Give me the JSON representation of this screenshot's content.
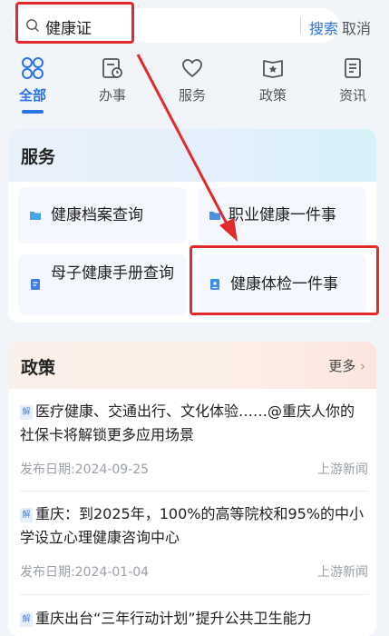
{
  "search": {
    "query": "健康证",
    "search_label": "搜索",
    "cancel_label": "取消"
  },
  "tabs": [
    {
      "label": "全部",
      "icon": "grid-icon",
      "active": true
    },
    {
      "label": "办事",
      "icon": "clipboard-clock-icon",
      "active": false
    },
    {
      "label": "服务",
      "icon": "heart-icon",
      "active": false
    },
    {
      "label": "政策",
      "icon": "book-star-icon",
      "active": false
    },
    {
      "label": "资讯",
      "icon": "document-icon",
      "active": false
    }
  ],
  "services": {
    "title": "服务",
    "items": [
      {
        "label": "健康档案查询",
        "icon": "folder-icon"
      },
      {
        "label": "职业健康一件事",
        "icon": "folder-icon"
      },
      {
        "label": "母子健康手册查询",
        "icon": "notebook-icon"
      },
      {
        "label": "健康体检一件事",
        "icon": "medical-report-icon"
      }
    ]
  },
  "policy": {
    "title": "政策",
    "more_label": "更多",
    "tag": "解",
    "items": [
      {
        "title": "医疗健康、交通出行、文化体验……@重庆人你的社保卡将解锁更多应用场景",
        "date": "发布日期:2024-09-25",
        "source": "上游新闻"
      },
      {
        "title": "重庆：到2025年，100%的高等院校和95%的中小学设立心理健康咨询中心",
        "date": "发布日期:2024-01-04",
        "source": "上游新闻"
      },
      {
        "title": "重庆出台“三年行动计划”提升公共卫生能力",
        "date": "",
        "source": ""
      }
    ]
  },
  "colors": {
    "accent": "#2a73e8",
    "annotation": "#e32a2a",
    "background": "#f1f4f9"
  }
}
